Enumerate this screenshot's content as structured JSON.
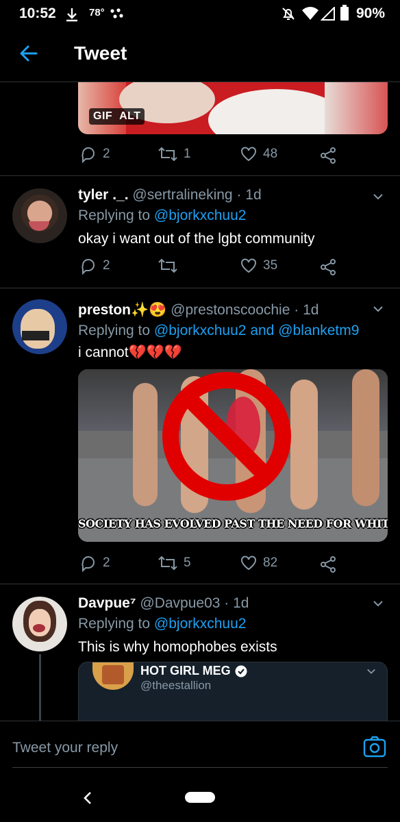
{
  "status_bar": {
    "time": "10:52",
    "temperature": "78°",
    "battery": "90%"
  },
  "header": {
    "title": "Tweet"
  },
  "top_media": {
    "gif_label": "GIF",
    "alt_label": "ALT",
    "replies": "2",
    "retweets": "1",
    "likes": "48"
  },
  "tweets": [
    {
      "display_name": "tyler ._.",
      "handle": "@sertralineking",
      "time": "· 1d",
      "replying_prefix": "Replying to",
      "replying_to": "@bjorkxchuu2",
      "text": "okay i want out of the lgbt community",
      "replies": "2",
      "retweets": "",
      "likes": "35"
    },
    {
      "display_name": "preston",
      "name_emojis": "✨😍",
      "handle": "@prestonscoochie",
      "time": "· 1d",
      "replying_prefix": "Replying to",
      "replying_to": "@bjorkxchuu2",
      "replying_and": "and",
      "replying_to_2": "@blanketm9",
      "text": "i cannot",
      "text_emojis": "💔💔💔",
      "image_caption": "SOCIETY HAS EVOLVED PAST THE NEED FOR WHITE GAYS",
      "replies": "2",
      "retweets": "5",
      "likes": "82"
    },
    {
      "display_name": "Davpue⁷",
      "handle": "@Davpue03",
      "time": "· 1d",
      "replying_prefix": "Replying to",
      "replying_to": "@bjorkxchuu2",
      "text": "This is why homophobes exists",
      "quote": {
        "display_name": "HOT GIRL MEG",
        "handle": "@theestallion"
      }
    }
  ],
  "reply_bar": {
    "placeholder": "Tweet your reply"
  },
  "colors": {
    "background": "#000000",
    "accent": "#1da1f2",
    "muted": "#8899a6",
    "divider": "#2f3336"
  }
}
